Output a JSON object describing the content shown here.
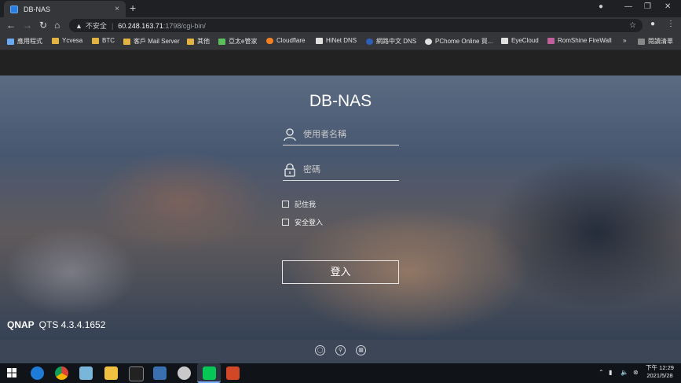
{
  "browser": {
    "tab_title": "DB-NAS",
    "new_tab": "+",
    "close_tab": "×",
    "insecure_label": "不安全",
    "url_host": "60.248.163.71",
    "url_path": ":1798/cgi-bin/",
    "bookmarks": [
      {
        "label": "應用程式",
        "color": "#6aa9f4"
      },
      {
        "label": "Ycvesa",
        "color": "#e3b341"
      },
      {
        "label": "BTC",
        "color": "#e3b341"
      },
      {
        "label": "客戶 Mail Server",
        "color": "#e3b341"
      },
      {
        "label": "其他",
        "color": "#e3b341"
      },
      {
        "label": "亞太e管家",
        "color": "#5bbf5b"
      },
      {
        "label": "Cloudflare",
        "color": "#f38020"
      },
      {
        "label": "HiNet DNS",
        "color": "#e0e0e0"
      },
      {
        "label": "網路中文 DNS",
        "color": "#2d5fb8"
      },
      {
        "label": "PChome Online 買...",
        "color": "#e0e0e0"
      },
      {
        "label": "EyeCloud",
        "color": "#e0e0e0"
      },
      {
        "label": "RomShine FireWall",
        "color": "#c0609a"
      }
    ],
    "bookmarks_more": "»",
    "reading_list": "閱讀清單"
  },
  "login": {
    "title": "DB-NAS",
    "username_placeholder": "使用者名稱",
    "password_placeholder": "密碼",
    "remember_me": "記住我",
    "secure_login": "安全登入",
    "login_button": "登入"
  },
  "brand": {
    "name": "QNAP",
    "version": "QTS 4.3.4.1652"
  },
  "taskbar": {
    "time": "下午 12:29",
    "date": "2021/5/28"
  }
}
